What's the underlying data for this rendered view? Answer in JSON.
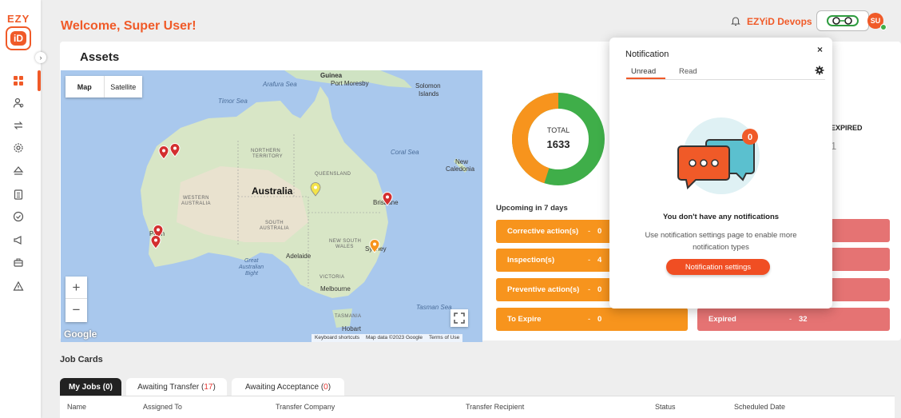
{
  "brand": {
    "logo_text": "EZY",
    "logo_badge": "iD"
  },
  "header": {
    "welcome": "Welcome, Super User!",
    "org_name": "EZYiD Devops",
    "avatar_initials": "SU"
  },
  "sidebar": {
    "items": [
      {
        "icon": "dashboard-icon"
      },
      {
        "icon": "users-icon"
      },
      {
        "icon": "transfer-icon"
      },
      {
        "icon": "settings-icon"
      },
      {
        "icon": "layers-icon"
      },
      {
        "icon": "clipboard-icon"
      },
      {
        "icon": "check-circle-icon"
      },
      {
        "icon": "megaphone-icon"
      },
      {
        "icon": "briefcase-icon"
      },
      {
        "icon": "warning-icon"
      }
    ]
  },
  "assets": {
    "title": "Assets",
    "map": {
      "type_map": "Map",
      "type_satellite": "Satellite",
      "zoom_in": "+",
      "zoom_out": "−",
      "google": "Google",
      "footer": [
        "Keyboard shortcuts",
        "Map data ©2023 Google",
        "Terms of Use"
      ],
      "labels": {
        "arafura": "Arafura Sea",
        "guinea": "Guinea",
        "port_moresby": "Port Moresby",
        "solomon": "Solomon",
        "islands": "Islands",
        "timor": "Timor Sea",
        "coral": "Coral Sea",
        "new": "New",
        "caledonia": "Caledonia",
        "northern": "NORTHERN",
        "territory": "TERRITORY",
        "queensland": "QUEENSLAND",
        "australia": "Australia",
        "western": "WESTERN",
        "western2": "AUSTRALIA",
        "south": "SOUTH",
        "south2": "AUSTRALIA",
        "brisbane": "Brisbane",
        "perth": "Perth",
        "nsw1": "NEW SOUTH",
        "nsw2": "WALES",
        "sydney": "Sydney",
        "adelaide": "Adelaide",
        "gab1": "Great",
        "gab2": "Australian",
        "gab3": "Bight",
        "victoria": "VICTORIA",
        "melbourne": "Melbourne",
        "tasman": "Tasman Sea",
        "tasmania": "TASMANIA",
        "hobart": "Hobart"
      }
    },
    "donut": {
      "label": "TOTAL",
      "total": "1633",
      "orange_fraction": 0.45,
      "green_fraction": 0.55
    },
    "expired_header": "EXPIRED",
    "expired_partial": "1",
    "upcoming_title": "Upcoming in 7 days",
    "status_left": [
      {
        "label": "Corrective action(s)",
        "value": "0"
      },
      {
        "label": "Inspection(s)",
        "value": "4"
      },
      {
        "label": "Preventive action(s)",
        "value": "0"
      },
      {
        "label": "To Expire",
        "value": "0"
      }
    ],
    "status_right": [
      {
        "label": "Expired",
        "value": "32"
      }
    ],
    "separator": "-"
  },
  "job_cards": {
    "title": "Job Cards",
    "tabs": [
      {
        "label": "My Jobs",
        "count": "0"
      },
      {
        "label": "Awaiting Transfer",
        "count": "17"
      },
      {
        "label": "Awaiting Acceptance",
        "count": "0"
      }
    ],
    "columns": [
      "Name",
      "Assigned To",
      "Transfer Company",
      "Transfer Recipient",
      "Status",
      "Scheduled Date"
    ]
  },
  "notification": {
    "title": "Notification",
    "close": "×",
    "tabs": [
      "Unread",
      "Read"
    ],
    "badge_count": "0",
    "empty_title": "You don't have any notifications",
    "hint": "Use notification settings page to enable more notification types",
    "button": "Notification settings"
  },
  "colors": {
    "accent": "#f05a28",
    "orange": "#f7941d",
    "red": "#e57373",
    "green": "#3fae49"
  }
}
